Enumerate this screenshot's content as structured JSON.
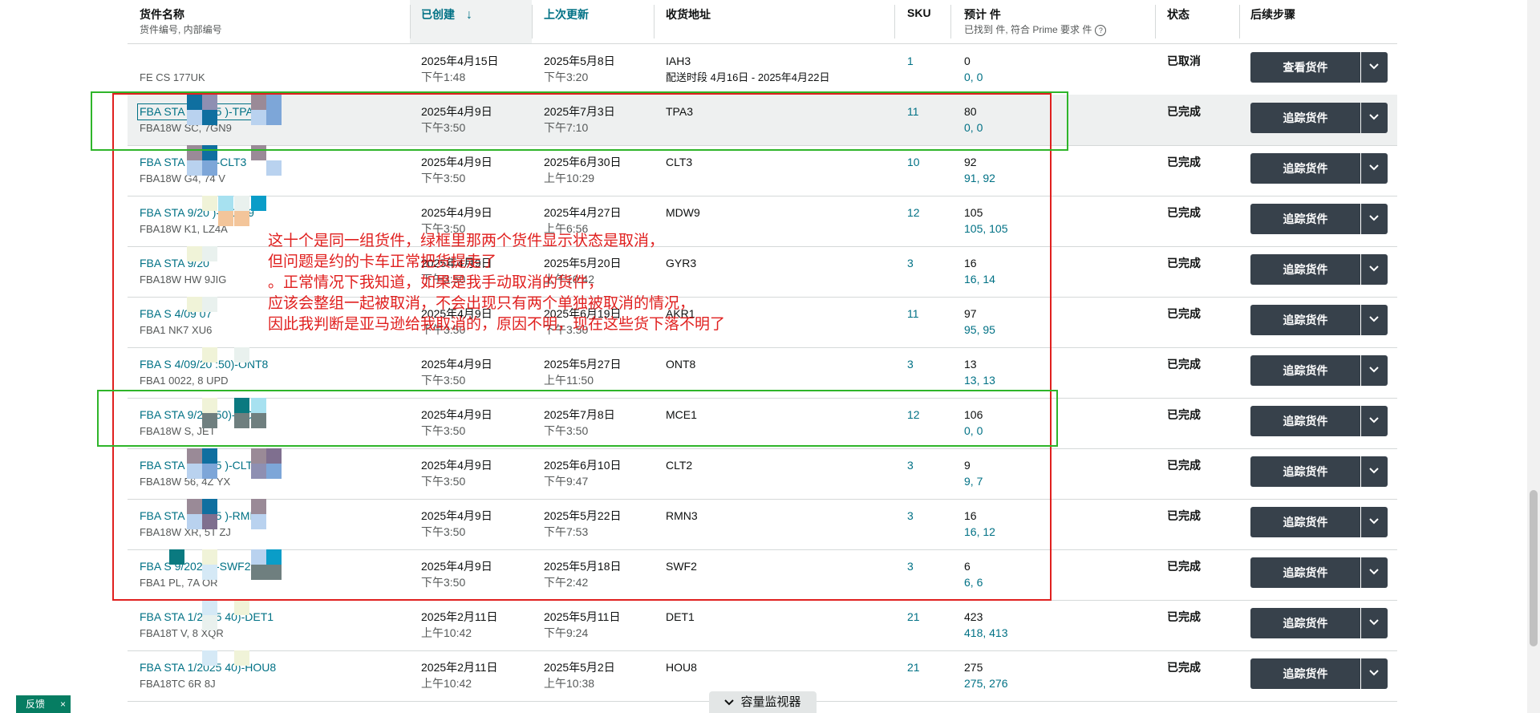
{
  "header": {
    "name_col": "货件名称",
    "name_sub": "货件编号, 内部编号",
    "created_col": "已创建",
    "updated_col": "上次更新",
    "dest_col": "收货地址",
    "sku_col": "SKU",
    "units_col": "预计 件",
    "units_sub": "已找到 件, 符合 Prime 要求 件",
    "status_col": "状态",
    "next_col": "后续步骤"
  },
  "rows": [
    {
      "name": "",
      "sub": "FE          CS          177UK",
      "created_date": "2025年4月15日",
      "created_time": "下午1:48",
      "updated_date": "2025年5月8日",
      "updated_time": "下午3:20",
      "dest": "IAH3",
      "dest_sub": "配送时段 4月16日 - 2025年4月22日",
      "sku": "1",
      "units": "0",
      "units_sub": "0, 0",
      "status": "已取消",
      "action": "查看货件"
    },
    {
      "name": "FBA STA          9/2025        )-TPA3",
      "sub": "FBA18W          SC, 7GN9",
      "created_date": "2025年4月9日",
      "created_time": "下午3:50",
      "updated_date": "2025年7月3日",
      "updated_time": "下午7:10",
      "dest": "TPA3",
      "dest_sub": "",
      "sku": "11",
      "units": "80",
      "units_sub": "0, 0",
      "status": "已完成",
      "action": "追踪货件"
    },
    {
      "name": "FBA STA          9/20          )-CLT3",
      "sub": "FBA18W          G4, 74          V",
      "created_date": "2025年4月9日",
      "created_time": "下午3:50",
      "updated_date": "2025年6月30日",
      "updated_time": "上午10:29",
      "dest": "CLT3",
      "dest_sub": "",
      "sku": "10",
      "units": "92",
      "units_sub": "91, 92",
      "status": "已完成",
      "action": "追踪货件"
    },
    {
      "name": "FBA STA          9/20          )-MDW9",
      "sub": "FBA18W          K1,          LZ4A",
      "created_date": "2025年4月9日",
      "created_time": "下午3:50",
      "updated_date": "2025年4月27日",
      "updated_time": "上午6:56",
      "dest": "MDW9",
      "dest_sub": "",
      "sku": "12",
      "units": "105",
      "units_sub": "105, 105",
      "status": "已完成",
      "action": "追踪货件"
    },
    {
      "name": "FBA STA          9/20",
      "sub": "FBA18W          HW          9JIG",
      "created_date": "2025年4月9日",
      "created_time": "下午3:50",
      "updated_date": "2025年5月20日",
      "updated_time": "上午10:42",
      "dest": "GYR3",
      "dest_sub": "",
      "sku": "3",
      "units": "16",
      "units_sub": "16, 14",
      "status": "已完成",
      "action": "追踪货件"
    },
    {
      "name": "FBA S          4/09          07",
      "sub": "FBA1          NK7          XU6",
      "created_date": "2025年4月9日",
      "created_time": "下午3:50",
      "updated_date": "2025年6月19日",
      "updated_time": "下午3:50",
      "dest": "AKR1",
      "dest_sub": "",
      "sku": "11",
      "units": "97",
      "units_sub": "95, 95",
      "status": "已完成",
      "action": "追踪货件"
    },
    {
      "name": "FBA S          4/09/20          :50)-ONT8",
      "sub": "FBA1          0022, 8          UPD",
      "created_date": "2025年4月9日",
      "created_time": "下午3:50",
      "updated_date": "2025年5月27日",
      "updated_time": "上午11:50",
      "dest": "ONT8",
      "dest_sub": "",
      "sku": "3",
      "units": "13",
      "units_sub": "13, 13",
      "status": "已完成",
      "action": "追踪货件"
    },
    {
      "name": "FBA STA          9/20          :50)-MCE1",
      "sub": "FBA18W          S,          JET",
      "created_date": "2025年4月9日",
      "created_time": "下午3:50",
      "updated_date": "2025年7月8日",
      "updated_time": "下午3:50",
      "dest": "MCE1",
      "dest_sub": "",
      "sku": "12",
      "units": "106",
      "units_sub": "0, 0",
      "status": "已完成",
      "action": "追踪货件"
    },
    {
      "name": "FBA STA          9/2025          )-CLT2",
      "sub": "FBA18W          56, 4Z          YX",
      "created_date": "2025年4月9日",
      "created_time": "下午3:50",
      "updated_date": "2025年6月10日",
      "updated_time": "下午9:47",
      "dest": "CLT2",
      "dest_sub": "",
      "sku": "3",
      "units": "9",
      "units_sub": "9, 7",
      "status": "已完成",
      "action": "追踪货件"
    },
    {
      "name": "FBA STA          9/2025          )-RMN3",
      "sub": "FBA18W          XR, 5T          ZJ",
      "created_date": "2025年4月9日",
      "created_time": "下午3:50",
      "updated_date": "2025年5月22日",
      "updated_time": "下午7:53",
      "dest": "RMN3",
      "dest_sub": "",
      "sku": "3",
      "units": "16",
      "units_sub": "16, 12",
      "status": "已完成",
      "action": "追踪货件"
    },
    {
      "name": "FBA S          9/2025          )-SWF2",
      "sub": "FBA1          PL, 7A          OR",
      "created_date": "2025年4月9日",
      "created_time": "下午3:50",
      "updated_date": "2025年5月18日",
      "updated_time": "下午2:42",
      "dest": "SWF2",
      "dest_sub": "",
      "sku": "3",
      "units": "6",
      "units_sub": "6, 6",
      "status": "已完成",
      "action": "追踪货件"
    },
    {
      "name": "FBA STA          1/2025          40)-DET1",
      "sub": "FBA18T          V, 8          XQR",
      "created_date": "2025年2月11日",
      "created_time": "上午10:42",
      "updated_date": "2025年5月11日",
      "updated_time": "下午9:24",
      "dest": "DET1",
      "dest_sub": "",
      "sku": "21",
      "units": "423",
      "units_sub": "418, 413",
      "status": "已完成",
      "action": "追踪货件"
    },
    {
      "name": "FBA STA          1/2025          40)-HOU8",
      "sub": "FBA18TC          6R          8J",
      "created_date": "2025年2月11日",
      "created_time": "上午10:42",
      "updated_date": "2025年5月2日",
      "updated_time": "上午10:38",
      "dest": "HOU8",
      "dest_sub": "",
      "sku": "21",
      "units": "275",
      "units_sub": "275, 276",
      "status": "已完成",
      "action": "追踪货件"
    }
  ],
  "annotation": {
    "lines": [
      "这十个是同一组货件，绿框里那两个货件显示状态是取消，",
      "但问题是约的卡车正常把货提走了",
      "。正常情况下我知道，如果是我手动取消的货件，",
      "应该会整组一起被取消，不会出现只有两个单独被取消的情况，",
      "因此我判断是亚马逊给我取消的，原因不明，现在这些货下落不明了"
    ]
  },
  "footer": {
    "feedback_label": "反馈",
    "feedback_close": "×",
    "monitor_label": "容量监视器"
  },
  "colors": {
    "link": "#007185",
    "button": "#37414b",
    "red_box": "#e0201f",
    "green_box": "#2fb52a",
    "feedback": "#067d62"
  }
}
